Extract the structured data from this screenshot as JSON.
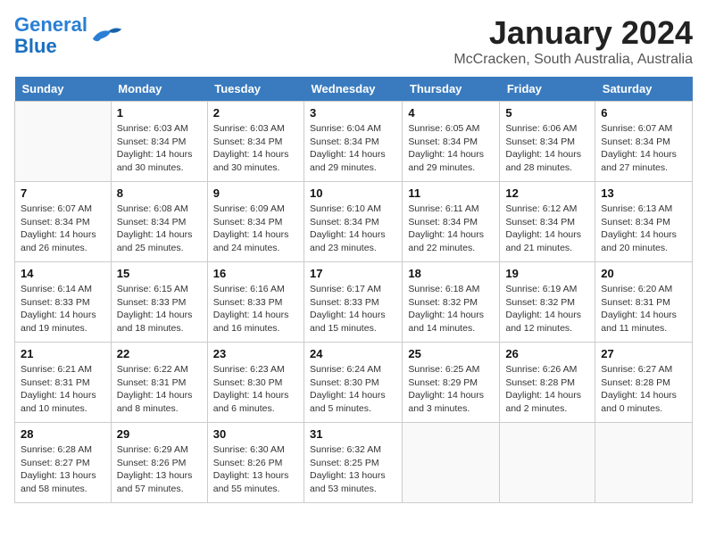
{
  "header": {
    "logo_line1": "General",
    "logo_line2": "Blue",
    "month": "January 2024",
    "location": "McCracken, South Australia, Australia"
  },
  "days_of_week": [
    "Sunday",
    "Monday",
    "Tuesday",
    "Wednesday",
    "Thursday",
    "Friday",
    "Saturday"
  ],
  "weeks": [
    [
      {
        "num": "",
        "sunrise": "",
        "sunset": "",
        "daylight": ""
      },
      {
        "num": "1",
        "sunrise": "Sunrise: 6:03 AM",
        "sunset": "Sunset: 8:34 PM",
        "daylight": "Daylight: 14 hours and 30 minutes."
      },
      {
        "num": "2",
        "sunrise": "Sunrise: 6:03 AM",
        "sunset": "Sunset: 8:34 PM",
        "daylight": "Daylight: 14 hours and 30 minutes."
      },
      {
        "num": "3",
        "sunrise": "Sunrise: 6:04 AM",
        "sunset": "Sunset: 8:34 PM",
        "daylight": "Daylight: 14 hours and 29 minutes."
      },
      {
        "num": "4",
        "sunrise": "Sunrise: 6:05 AM",
        "sunset": "Sunset: 8:34 PM",
        "daylight": "Daylight: 14 hours and 29 minutes."
      },
      {
        "num": "5",
        "sunrise": "Sunrise: 6:06 AM",
        "sunset": "Sunset: 8:34 PM",
        "daylight": "Daylight: 14 hours and 28 minutes."
      },
      {
        "num": "6",
        "sunrise": "Sunrise: 6:07 AM",
        "sunset": "Sunset: 8:34 PM",
        "daylight": "Daylight: 14 hours and 27 minutes."
      }
    ],
    [
      {
        "num": "7",
        "sunrise": "Sunrise: 6:07 AM",
        "sunset": "Sunset: 8:34 PM",
        "daylight": "Daylight: 14 hours and 26 minutes."
      },
      {
        "num": "8",
        "sunrise": "Sunrise: 6:08 AM",
        "sunset": "Sunset: 8:34 PM",
        "daylight": "Daylight: 14 hours and 25 minutes."
      },
      {
        "num": "9",
        "sunrise": "Sunrise: 6:09 AM",
        "sunset": "Sunset: 8:34 PM",
        "daylight": "Daylight: 14 hours and 24 minutes."
      },
      {
        "num": "10",
        "sunrise": "Sunrise: 6:10 AM",
        "sunset": "Sunset: 8:34 PM",
        "daylight": "Daylight: 14 hours and 23 minutes."
      },
      {
        "num": "11",
        "sunrise": "Sunrise: 6:11 AM",
        "sunset": "Sunset: 8:34 PM",
        "daylight": "Daylight: 14 hours and 22 minutes."
      },
      {
        "num": "12",
        "sunrise": "Sunrise: 6:12 AM",
        "sunset": "Sunset: 8:34 PM",
        "daylight": "Daylight: 14 hours and 21 minutes."
      },
      {
        "num": "13",
        "sunrise": "Sunrise: 6:13 AM",
        "sunset": "Sunset: 8:34 PM",
        "daylight": "Daylight: 14 hours and 20 minutes."
      }
    ],
    [
      {
        "num": "14",
        "sunrise": "Sunrise: 6:14 AM",
        "sunset": "Sunset: 8:33 PM",
        "daylight": "Daylight: 14 hours and 19 minutes."
      },
      {
        "num": "15",
        "sunrise": "Sunrise: 6:15 AM",
        "sunset": "Sunset: 8:33 PM",
        "daylight": "Daylight: 14 hours and 18 minutes."
      },
      {
        "num": "16",
        "sunrise": "Sunrise: 6:16 AM",
        "sunset": "Sunset: 8:33 PM",
        "daylight": "Daylight: 14 hours and 16 minutes."
      },
      {
        "num": "17",
        "sunrise": "Sunrise: 6:17 AM",
        "sunset": "Sunset: 8:33 PM",
        "daylight": "Daylight: 14 hours and 15 minutes."
      },
      {
        "num": "18",
        "sunrise": "Sunrise: 6:18 AM",
        "sunset": "Sunset: 8:32 PM",
        "daylight": "Daylight: 14 hours and 14 minutes."
      },
      {
        "num": "19",
        "sunrise": "Sunrise: 6:19 AM",
        "sunset": "Sunset: 8:32 PM",
        "daylight": "Daylight: 14 hours and 12 minutes."
      },
      {
        "num": "20",
        "sunrise": "Sunrise: 6:20 AM",
        "sunset": "Sunset: 8:31 PM",
        "daylight": "Daylight: 14 hours and 11 minutes."
      }
    ],
    [
      {
        "num": "21",
        "sunrise": "Sunrise: 6:21 AM",
        "sunset": "Sunset: 8:31 PM",
        "daylight": "Daylight: 14 hours and 10 minutes."
      },
      {
        "num": "22",
        "sunrise": "Sunrise: 6:22 AM",
        "sunset": "Sunset: 8:31 PM",
        "daylight": "Daylight: 14 hours and 8 minutes."
      },
      {
        "num": "23",
        "sunrise": "Sunrise: 6:23 AM",
        "sunset": "Sunset: 8:30 PM",
        "daylight": "Daylight: 14 hours and 6 minutes."
      },
      {
        "num": "24",
        "sunrise": "Sunrise: 6:24 AM",
        "sunset": "Sunset: 8:30 PM",
        "daylight": "Daylight: 14 hours and 5 minutes."
      },
      {
        "num": "25",
        "sunrise": "Sunrise: 6:25 AM",
        "sunset": "Sunset: 8:29 PM",
        "daylight": "Daylight: 14 hours and 3 minutes."
      },
      {
        "num": "26",
        "sunrise": "Sunrise: 6:26 AM",
        "sunset": "Sunset: 8:28 PM",
        "daylight": "Daylight: 14 hours and 2 minutes."
      },
      {
        "num": "27",
        "sunrise": "Sunrise: 6:27 AM",
        "sunset": "Sunset: 8:28 PM",
        "daylight": "Daylight: 14 hours and 0 minutes."
      }
    ],
    [
      {
        "num": "28",
        "sunrise": "Sunrise: 6:28 AM",
        "sunset": "Sunset: 8:27 PM",
        "daylight": "Daylight: 13 hours and 58 minutes."
      },
      {
        "num": "29",
        "sunrise": "Sunrise: 6:29 AM",
        "sunset": "Sunset: 8:26 PM",
        "daylight": "Daylight: 13 hours and 57 minutes."
      },
      {
        "num": "30",
        "sunrise": "Sunrise: 6:30 AM",
        "sunset": "Sunset: 8:26 PM",
        "daylight": "Daylight: 13 hours and 55 minutes."
      },
      {
        "num": "31",
        "sunrise": "Sunrise: 6:32 AM",
        "sunset": "Sunset: 8:25 PM",
        "daylight": "Daylight: 13 hours and 53 minutes."
      },
      {
        "num": "",
        "sunrise": "",
        "sunset": "",
        "daylight": ""
      },
      {
        "num": "",
        "sunrise": "",
        "sunset": "",
        "daylight": ""
      },
      {
        "num": "",
        "sunrise": "",
        "sunset": "",
        "daylight": ""
      }
    ]
  ]
}
